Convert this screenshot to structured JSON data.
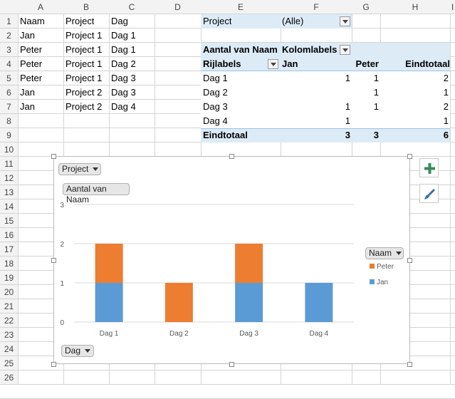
{
  "columns": [
    "A",
    "B",
    "C",
    "D",
    "E",
    "F",
    "G",
    "H",
    "I"
  ],
  "rows": [
    "1",
    "2",
    "3",
    "4",
    "5",
    "6",
    "7",
    "8",
    "9",
    "10",
    "11",
    "12",
    "13",
    "14",
    "15",
    "16",
    "17",
    "18",
    "19",
    "20",
    "21",
    "22",
    "23",
    "24",
    "25",
    "26"
  ],
  "data_table": {
    "headers": [
      "Naam",
      "Project",
      "Dag"
    ],
    "rows": [
      [
        "Jan",
        "Project 1",
        "Dag 1"
      ],
      [
        "Peter",
        "Project 1",
        "Dag 1"
      ],
      [
        "Peter",
        "Project 1",
        "Dag 2"
      ],
      [
        "Peter",
        "Project 1",
        "Dag 3"
      ],
      [
        "Jan",
        "Project 2",
        "Dag 3"
      ],
      [
        "Jan",
        "Project 2",
        "Dag 4"
      ]
    ]
  },
  "pivot": {
    "filter_label": "Project",
    "filter_value": "(Alle)",
    "values_label": "Aantal van Naam",
    "col_labels": "Kolomlabels",
    "row_labels": "Rijlabels",
    "col_jan": "Jan",
    "col_peter": "Peter",
    "col_total": "Eindtotaal",
    "rows": [
      {
        "label": "Dag 1",
        "jan": "1",
        "peter": "1",
        "total": "2"
      },
      {
        "label": "Dag 2",
        "jan": "",
        "peter": "1",
        "total": "1"
      },
      {
        "label": "Dag 3",
        "jan": "1",
        "peter": "1",
        "total": "2"
      },
      {
        "label": "Dag 4",
        "jan": "1",
        "peter": "",
        "total": "1"
      }
    ],
    "total_label": "Eindtotaal",
    "total_jan": "3",
    "total_peter": "3",
    "total_all": "6"
  },
  "chart_buttons": {
    "project": "Project",
    "values": "Aantal van Naam",
    "legend": "Naam",
    "axis": "Dag"
  },
  "chart_data": {
    "type": "bar",
    "stacked": true,
    "categories": [
      "Dag 1",
      "Dag 2",
      "Dag 3",
      "Dag 4"
    ],
    "series": [
      {
        "name": "Jan",
        "values": [
          1,
          0,
          1,
          1
        ],
        "color": "#5b9bd5"
      },
      {
        "name": "Peter",
        "values": [
          1,
          1,
          1,
          0
        ],
        "color": "#ed7d31"
      }
    ],
    "ylim": [
      0,
      3
    ],
    "yticks": [
      "0",
      "1",
      "2",
      "3"
    ],
    "legend_position": "right",
    "grid": true
  },
  "colors": {
    "pivot_header": "#ddebf7",
    "jan": "#5b9bd5",
    "peter": "#ed7d31"
  }
}
